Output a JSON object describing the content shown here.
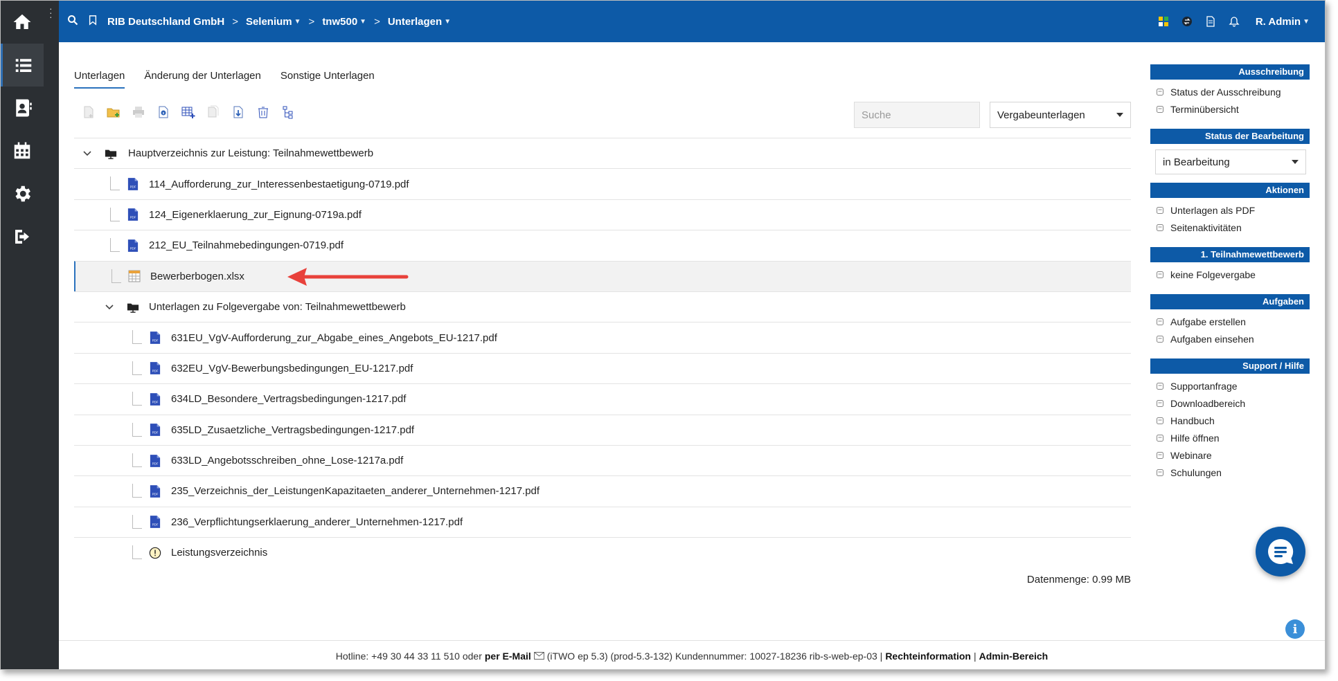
{
  "topbar": {
    "org": "RIB Deutschland GmbH",
    "crumb1": "Selenium",
    "crumb2": "tnw500",
    "crumb3": "Unterlagen",
    "user": "R. Admin"
  },
  "tabs": [
    "Unterlagen",
    "Änderung der Unterlagen",
    "Sonstige Unterlagen"
  ],
  "search": {
    "placeholder": "Suche"
  },
  "doc_select": {
    "value": "Vergabeunterlagen"
  },
  "tree": {
    "root": "Hauptverzeichnis zur Leistung: Teilnahmewettbewerb",
    "files1": [
      "114_Aufforderung_zur_Interessenbestaetigung-0719.pdf",
      "124_Eigenerklaerung_zur_Eignung-0719a.pdf",
      "212_EU_Teilnahmebedingungen-0719.pdf",
      "Bewerberbogen.xlsx"
    ],
    "sub": "Unterlagen zu Folgevergabe von: Teilnahmewettbewerb",
    "files2": [
      "631EU_VgV-Aufforderung_zur_Abgabe_eines_Angebots_EU-1217.pdf",
      "632EU_VgV-Bewerbungsbedingungen_EU-1217.pdf",
      "634LD_Besondere_Vertragsbedingungen-1217.pdf",
      "635LD_Zusaetzliche_Vertragsbedingungen-1217.pdf",
      "633LD_Angebotsschreiben_ohne_Lose-1217a.pdf",
      "235_Verzeichnis_der_LeistungenKapazitaeten_anderer_Unternehmen-1217.pdf",
      "236_Verpflichtungserklaerung_anderer_Unternehmen-1217.pdf"
    ],
    "warning_item": "Leistungsverzeichnis"
  },
  "datamenge": "Datenmenge: 0.99 MB",
  "panel": {
    "ausschreibung": {
      "title": "Ausschreibung",
      "items": [
        "Status der Ausschreibung",
        "Terminübersicht"
      ]
    },
    "status": {
      "title": "Status der Bearbeitung",
      "value": "in Bearbeitung"
    },
    "aktionen": {
      "title": "Aktionen",
      "items": [
        "Unterlagen als PDF",
        "Seitenaktivitäten"
      ]
    },
    "teilnahme": {
      "title": "1. Teilnahmewettbewerb",
      "items": [
        "keine Folgevergabe"
      ]
    },
    "aufgaben": {
      "title": "Aufgaben",
      "items": [
        "Aufgabe erstellen",
        "Aufgaben einsehen"
      ]
    },
    "support": {
      "title": "Support / Hilfe",
      "items": [
        "Supportanfrage",
        "Downloadbereich",
        "Handbuch",
        "Hilfe öffnen",
        "Webinare",
        "Schulungen"
      ]
    }
  },
  "footer": {
    "hotline": "Hotline: +49 30 44 33 11 510 oder",
    "email": "per E-Mail",
    "version": "(iTWO ep 5.3) (prod-5.3-132)  Kundennummer: 10027-18236 rib-s-web-ep-03 |",
    "recht": "Rechteinformation",
    "pipe": "|",
    "admin": "Admin-Bereich"
  },
  "colors": {
    "brand": "#0d5aa7",
    "rail": "#2b2f33",
    "arrow": "#e8413b",
    "pdf": "#2e4fb8"
  }
}
